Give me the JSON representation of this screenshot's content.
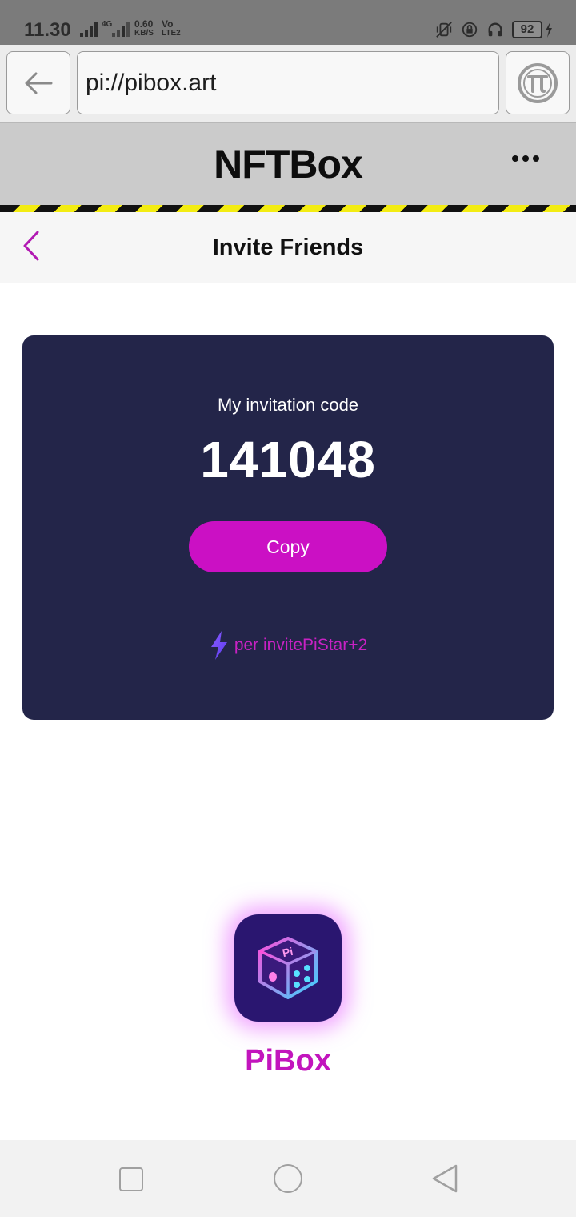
{
  "status_bar": {
    "time": "11.30",
    "net_gen": "4G",
    "speed_value": "0.60",
    "speed_unit": "KB/S",
    "volte_top": "Vo",
    "volte_bottom": "LTE2",
    "battery": "92"
  },
  "browser": {
    "url": "pi://pibox.art"
  },
  "app": {
    "title": "NFTBox"
  },
  "page": {
    "title": "Invite Friends"
  },
  "invite_card": {
    "label": "My invitation code",
    "code": "141048",
    "copy_label": "Copy",
    "reward_text": "per invitePiStar+2"
  },
  "logo": {
    "name": "PiBox",
    "icon_text": "Pi"
  },
  "colors": {
    "card_bg": "#232549",
    "accent": "#cb10c4",
    "header_bg": "#cbcbcb"
  },
  "icons": [
    "back-arrow-icon",
    "pi-network-icon",
    "more-dots-icon",
    "chevron-left-icon",
    "lightning-icon",
    "dice-logo-icon",
    "nav-recents-icon",
    "nav-home-icon",
    "nav-back-icon"
  ]
}
